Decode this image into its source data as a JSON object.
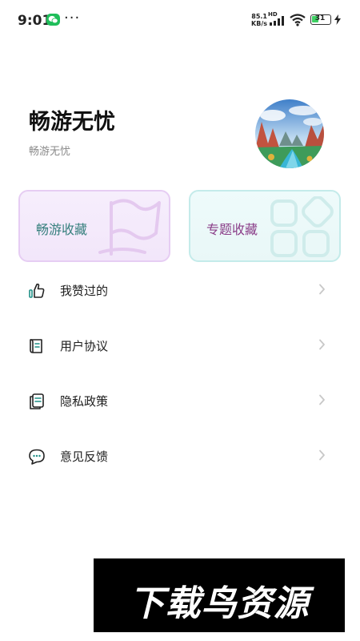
{
  "status_bar": {
    "time": "9:01",
    "dots": "···",
    "net_speed_value": "85.1",
    "net_speed_unit": "KB/s",
    "network_type": "HD",
    "battery": "31",
    "icons": [
      "wechat-icon",
      "signal-icon",
      "wifi-icon",
      "battery-icon",
      "charging-bolt-icon"
    ]
  },
  "profile": {
    "title": "畅游无忧",
    "subtitle": "畅游无忧",
    "avatar": "landscape-avatar"
  },
  "cards": [
    {
      "label": "畅游收藏",
      "icon": "flag-icon",
      "accent": "#37807e"
    },
    {
      "label": "专题收藏",
      "icon": "grid-icon",
      "accent": "#8a3d88"
    }
  ],
  "menu": {
    "items": [
      {
        "label": "我赞过的",
        "icon": "thumbs-up-icon"
      },
      {
        "label": "用户协议",
        "icon": "agreement-icon"
      },
      {
        "label": "隐私政策",
        "icon": "document-icon"
      },
      {
        "label": "意见反馈",
        "icon": "chat-bubble-icon"
      }
    ]
  },
  "watermark": {
    "text": "下载鸟资源"
  }
}
